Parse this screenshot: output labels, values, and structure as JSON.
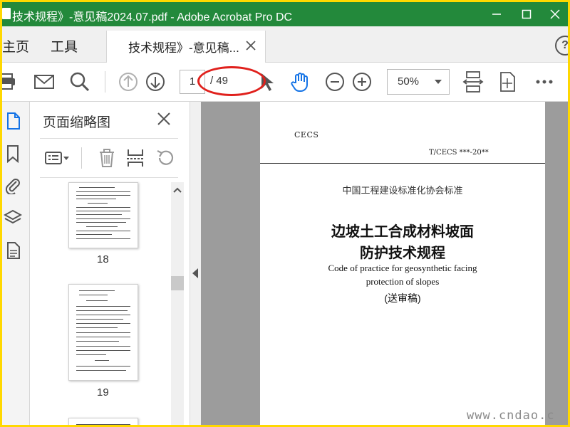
{
  "window": {
    "title": "技术规程》-意见稿2024.07.pdf - Adobe Acrobat Pro DC"
  },
  "nav": {
    "home": "主页",
    "tools": "工具",
    "doc_tab": "技术规程》-意见稿..."
  },
  "toolbar": {
    "current_page": "1",
    "total_pages": "/ 49",
    "zoom": "50%"
  },
  "thumbnails": {
    "panel_title": "页面缩略图",
    "pages": [
      {
        "number": "18"
      },
      {
        "number": "19"
      }
    ]
  },
  "document": {
    "org": "CECS",
    "std_number": "T/CECS ***-20**",
    "association": "中国工程建设标准化协会标准",
    "title_line1": "边坡土工合成材料坡面",
    "title_line2": "防护技术规程",
    "en_title_line1": "Code of practice for geosynthetic facing",
    "en_title_line2": "protection of slopes",
    "draft": "(送审稿)"
  },
  "watermark": "www.cndao.c",
  "colors": {
    "titlebar": "#23893b",
    "annotation": "#e0201c",
    "accent_blue": "#1473e6",
    "outer_border": "#ffd800"
  }
}
